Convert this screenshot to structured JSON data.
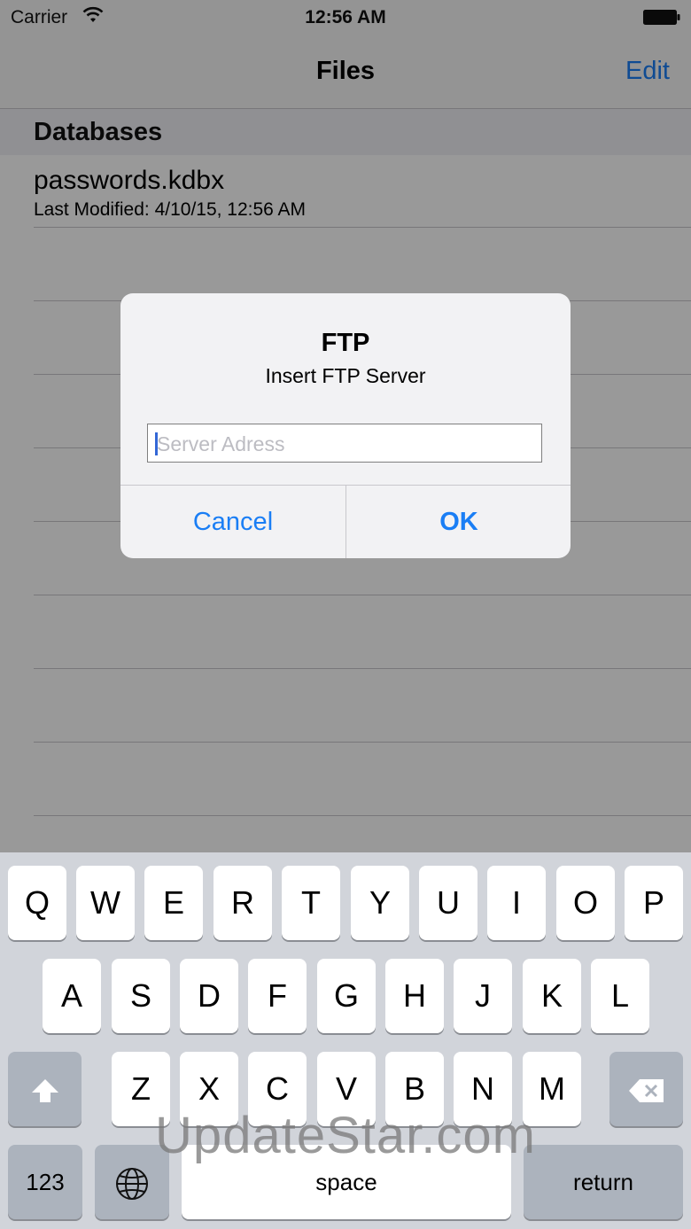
{
  "status_bar": {
    "carrier": "Carrier",
    "time": "12:56 AM"
  },
  "nav": {
    "title": "Files",
    "edit_label": "Edit"
  },
  "table": {
    "section_title": "Databases",
    "rows": [
      {
        "title": "passwords.kdbx",
        "subtitle": "Last Modified: 4/10/15, 12:56 AM"
      }
    ]
  },
  "alert": {
    "title": "FTP",
    "message": "Insert FTP Server",
    "input_placeholder": "Server Adress",
    "input_value": "",
    "cancel_label": "Cancel",
    "ok_label": "OK"
  },
  "keyboard": {
    "row1": [
      "Q",
      "W",
      "E",
      "R",
      "T",
      "Y",
      "U",
      "I",
      "O",
      "P"
    ],
    "row2": [
      "A",
      "S",
      "D",
      "F",
      "G",
      "H",
      "J",
      "K",
      "L"
    ],
    "row3": [
      "Z",
      "X",
      "C",
      "V",
      "B",
      "N",
      "M"
    ],
    "numbers_label": "123",
    "space_label": "space",
    "return_label": "return"
  },
  "watermark": "UpdateStar.com",
  "colors": {
    "accent": "#1a7ef5",
    "keyboard_bg": "#d1d4da"
  }
}
